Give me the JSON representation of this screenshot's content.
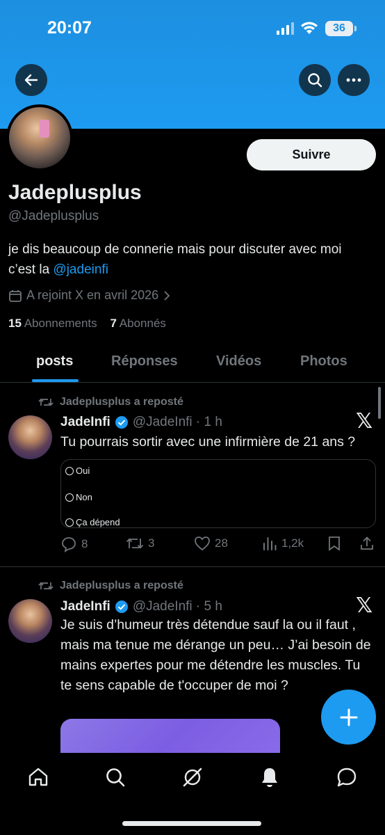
{
  "status_bar": {
    "time": "20:07",
    "battery": "36"
  },
  "profile": {
    "display_name": "Jadeplusplus",
    "handle": "@Jadeplusplus",
    "bio_text": "je dis beaucoup de connerie mais pour discuter avec moi c’est la ",
    "bio_link": "@jadeinfi",
    "joined": "A rejoint X en avril 2026",
    "following_count": "15",
    "following_label": "Abonnements",
    "followers_count": "7",
    "followers_label": "Abonnés"
  },
  "follow_button": {
    "label": "Suivre"
  },
  "tabs": [
    {
      "label": "posts",
      "active": true
    },
    {
      "label": "Réponses",
      "active": false
    },
    {
      "label": "Vidéos",
      "active": false
    },
    {
      "label": "Photos",
      "active": false
    }
  ],
  "posts": [
    {
      "repost_label": "Jadeplusplus a reposté",
      "author": "JadeInfi",
      "meta": "@JadeInfi · 1 h",
      "text": "Tu pourrais sortir avec une infirmière de 21 ans ?",
      "poll": [
        "Oui",
        "Non",
        "Ça dépend"
      ],
      "replies": "8",
      "reposts": "3",
      "likes": "28",
      "views": "1,2k"
    },
    {
      "repost_label": "Jadeplusplus a reposté",
      "author": "JadeInfi",
      "meta": "@JadeInfi · 5 h",
      "text": "Je suis d’humeur très détendue sauf la ou il faut , mais ma tenue me dérange un peu… J’ai besoin de mains expertes pour me détendre les muscles. Tu te sens capable de t'occuper de moi ?"
    }
  ],
  "colors": {
    "accent": "#1d9bf0",
    "background": "#000000",
    "muted": "#71767b",
    "text": "#e7e9ea"
  },
  "icons": [
    "back-arrow-icon",
    "search-icon",
    "more-icon",
    "calendar-icon",
    "chevron-right-icon",
    "repost-icon",
    "verified-icon",
    "x-logo-icon",
    "reply-icon",
    "like-icon",
    "views-icon",
    "bookmark-icon",
    "share-icon",
    "plus-icon",
    "home-icon",
    "grok-icon",
    "bell-icon",
    "messages-icon"
  ]
}
